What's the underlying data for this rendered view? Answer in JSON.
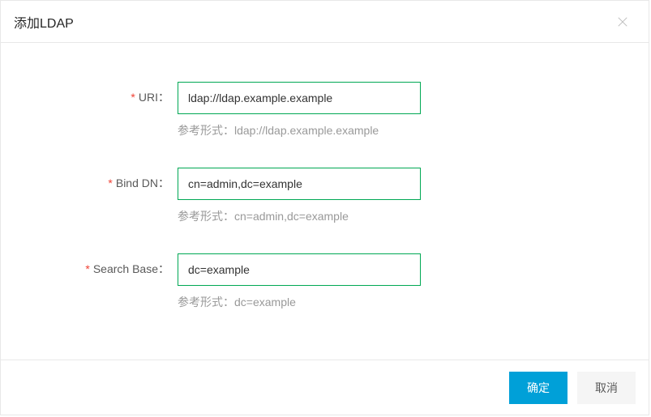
{
  "modal": {
    "title": "添加LDAP",
    "close_icon": "close"
  },
  "form": {
    "fields": [
      {
        "label": "URI",
        "value": "ldap://ldap.example.example",
        "placeholder": "",
        "hint": "参考形式：ldap://ldap.example.example",
        "required": true
      },
      {
        "label": "Bind DN",
        "value": "cn=admin,dc=example",
        "placeholder": "",
        "hint": "参考形式：cn=admin,dc=example",
        "required": true
      },
      {
        "label": "Search Base",
        "value": "dc=example",
        "placeholder": "",
        "hint": "参考形式：dc=example",
        "required": true
      }
    ]
  },
  "footer": {
    "ok_label": "确定",
    "cancel_label": "取消"
  },
  "required_marker": "*",
  "label_colon": "："
}
